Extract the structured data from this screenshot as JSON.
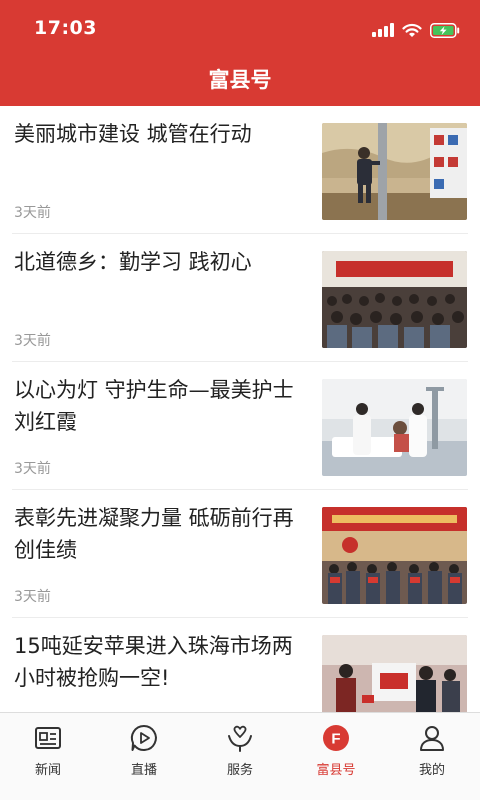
{
  "status_bar": {
    "time": "17:03"
  },
  "header": {
    "title": "富县号"
  },
  "news": [
    {
      "title": "美丽城市建设 城管在行动",
      "time": "3天前"
    },
    {
      "title": "北道德乡：勤学习 践初心",
      "time": "3天前"
    },
    {
      "title": "以心为灯 守护生命—最美护士刘红霞",
      "time": "3天前"
    },
    {
      "title": "表彰先进凝聚力量 砥砺前行再创佳绩",
      "time": "3天前"
    },
    {
      "title": "15吨延安苹果进入珠海市场两小时被抢购一空!",
      "time": ""
    }
  ],
  "tabbar": {
    "tabs": [
      {
        "label": "新闻",
        "icon": "newspaper-icon"
      },
      {
        "label": "直播",
        "icon": "play-icon"
      },
      {
        "label": "服务",
        "icon": "service-icon"
      },
      {
        "label": "富县号",
        "icon": "fuxian-icon",
        "badge": "F"
      },
      {
        "label": "我的",
        "icon": "user-icon"
      }
    ],
    "active_tab": "富县号"
  },
  "colors": {
    "brand": "#d83a33",
    "text": "#222222",
    "muted": "#999999"
  }
}
